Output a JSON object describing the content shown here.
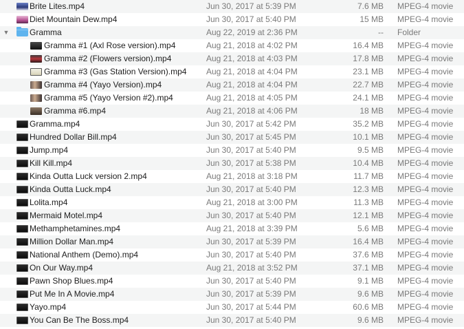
{
  "files": [
    {
      "name": "Brite Lites.mp4",
      "date": "Jun 30, 2017 at 5:39 PM",
      "size": "7.6 MB",
      "kind": "MPEG-4 movie",
      "icon": "thumb-blue",
      "indent": 0
    },
    {
      "name": "Diet Mountain Dew.mp4",
      "date": "Jun 30, 2017 at 5:40 PM",
      "size": "15 MB",
      "kind": "MPEG-4 movie",
      "icon": "thumb-pink",
      "indent": 0
    },
    {
      "name": "Gramma",
      "date": "Aug 22, 2019 at 2:36 PM",
      "size": "--",
      "kind": "Folder",
      "icon": "folder",
      "indent": 0,
      "disclosure": "▼"
    },
    {
      "name": "Gramma #1 (Axl Rose version).mp4",
      "date": "Aug 21, 2018 at 4:02 PM",
      "size": "16.4 MB",
      "kind": "MPEG-4 movie",
      "icon": "thumb-dark",
      "indent": 1
    },
    {
      "name": "Gramma #2 (Flowers version).mp4",
      "date": "Aug 21, 2018 at 4:03 PM",
      "size": "17.8 MB",
      "kind": "MPEG-4 movie",
      "icon": "thumb-red",
      "indent": 1
    },
    {
      "name": "Gramma #3 (Gas Station Version).mp4",
      "date": "Aug 21, 2018 at 4:04 PM",
      "size": "23.1 MB",
      "kind": "MPEG-4 movie",
      "icon": "thumb-light",
      "indent": 1
    },
    {
      "name": "Gramma #4 (Yayo Version).mp4",
      "date": "Aug 21, 2018 at 4:04 PM",
      "size": "22.7 MB",
      "kind": "MPEG-4 movie",
      "icon": "thumb-people",
      "indent": 1
    },
    {
      "name": "Gramma #5 (Yayo Version #2).mp4",
      "date": "Aug 21, 2018 at 4:05 PM",
      "size": "24.1 MB",
      "kind": "MPEG-4 movie",
      "icon": "thumb-people",
      "indent": 1
    },
    {
      "name": "Gramma #6.mp4",
      "date": "Aug 21, 2018 at 4:06 PM",
      "size": "18 MB",
      "kind": "MPEG-4 movie",
      "icon": "thumb-warm",
      "indent": 1
    },
    {
      "name": "Gramma.mp4",
      "date": "Jun 30, 2017 at 5:42 PM",
      "size": "35.2 MB",
      "kind": "MPEG-4 movie",
      "icon": "movie",
      "indent": 0
    },
    {
      "name": "Hundred Dollar Bill.mp4",
      "date": "Jun 30, 2017 at 5:45 PM",
      "size": "10.1 MB",
      "kind": "MPEG-4 movie",
      "icon": "movie",
      "indent": 0
    },
    {
      "name": "Jump.mp4",
      "date": "Jun 30, 2017 at 5:40 PM",
      "size": "9.5 MB",
      "kind": "MPEG-4 movie",
      "icon": "movie",
      "indent": 0
    },
    {
      "name": "Kill Kill.mp4",
      "date": "Jun 30, 2017 at 5:38 PM",
      "size": "10.4 MB",
      "kind": "MPEG-4 movie",
      "icon": "movie",
      "indent": 0
    },
    {
      "name": "Kinda Outta Luck version 2.mp4",
      "date": "Aug 21, 2018 at 3:18 PM",
      "size": "11.7 MB",
      "kind": "MPEG-4 movie",
      "icon": "movie",
      "indent": 0
    },
    {
      "name": "Kinda Outta Luck.mp4",
      "date": "Jun 30, 2017 at 5:40 PM",
      "size": "12.3 MB",
      "kind": "MPEG-4 movie",
      "icon": "movie",
      "indent": 0
    },
    {
      "name": "Lolita.mp4",
      "date": "Aug 21, 2018 at 3:00 PM",
      "size": "11.3 MB",
      "kind": "MPEG-4 movie",
      "icon": "movie",
      "indent": 0
    },
    {
      "name": "Mermaid Motel.mp4",
      "date": "Jun 30, 2017 at 5:40 PM",
      "size": "12.1 MB",
      "kind": "MPEG-4 movie",
      "icon": "movie",
      "indent": 0
    },
    {
      "name": "Methamphetamines.mp4",
      "date": "Aug 21, 2018 at 3:39 PM",
      "size": "5.6 MB",
      "kind": "MPEG-4 movie",
      "icon": "movie",
      "indent": 0
    },
    {
      "name": "Million Dollar Man.mp4",
      "date": "Jun 30, 2017 at 5:39 PM",
      "size": "16.4 MB",
      "kind": "MPEG-4 movie",
      "icon": "movie",
      "indent": 0
    },
    {
      "name": "National Anthem (Demo).mp4",
      "date": "Jun 30, 2017 at 5:40 PM",
      "size": "37.6 MB",
      "kind": "MPEG-4 movie",
      "icon": "movie",
      "indent": 0
    },
    {
      "name": "On Our Way.mp4",
      "date": "Aug 21, 2018 at 3:52 PM",
      "size": "37.1 MB",
      "kind": "MPEG-4 movie",
      "icon": "movie",
      "indent": 0
    },
    {
      "name": "Pawn Shop Blues.mp4",
      "date": "Jun 30, 2017 at 5:40 PM",
      "size": "9.1 MB",
      "kind": "MPEG-4 movie",
      "icon": "movie",
      "indent": 0
    },
    {
      "name": "Put Me In A Movie.mp4",
      "date": "Jun 30, 2017 at 5:39 PM",
      "size": "9.6 MB",
      "kind": "MPEG-4 movie",
      "icon": "movie",
      "indent": 0
    },
    {
      "name": "Yayo.mp4",
      "date": "Jun 30, 2017 at 5:44 PM",
      "size": "60.6 MB",
      "kind": "MPEG-4 movie",
      "icon": "movie",
      "indent": 0
    },
    {
      "name": "You Can Be The Boss.mp4",
      "date": "Jun 30, 2017 at 5:40 PM",
      "size": "9.6 MB",
      "kind": "MPEG-4 movie",
      "icon": "movie",
      "indent": 0
    }
  ]
}
